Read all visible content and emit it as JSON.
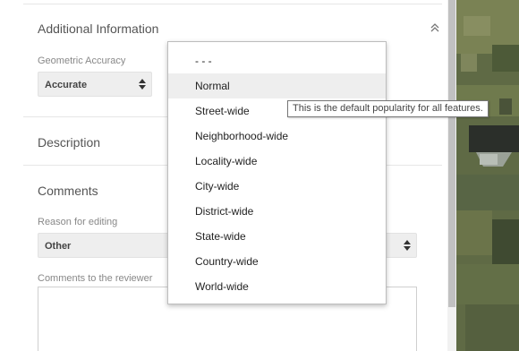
{
  "sections": {
    "additional_information": {
      "title": "Additional Information",
      "collapse_icon": "chevron-double-up-icon"
    },
    "description": {
      "title": "Description"
    },
    "comments": {
      "title": "Comments"
    }
  },
  "fields": {
    "geometric_accuracy": {
      "label": "Geometric Accuracy",
      "value": "Accurate"
    },
    "reason_for_editing": {
      "label": "Reason for editing",
      "value": "Other"
    },
    "comments_to_reviewer": {
      "label": "Comments to the reviewer",
      "value": ""
    }
  },
  "dropdown": {
    "hovered_index": 1,
    "options": [
      "- - -",
      "Normal",
      "Street-wide",
      "Neighborhood-wide",
      "Locality-wide",
      "City-wide",
      "District-wide",
      "State-wide",
      "Country-wide",
      "World-wide"
    ]
  },
  "tooltip": {
    "text": "This is the default popularity for all features."
  },
  "colors": {
    "hover_bg": "#eeeeee",
    "select_bg": "#eeeeee",
    "scroll_thumb": "#c1c1c1"
  }
}
